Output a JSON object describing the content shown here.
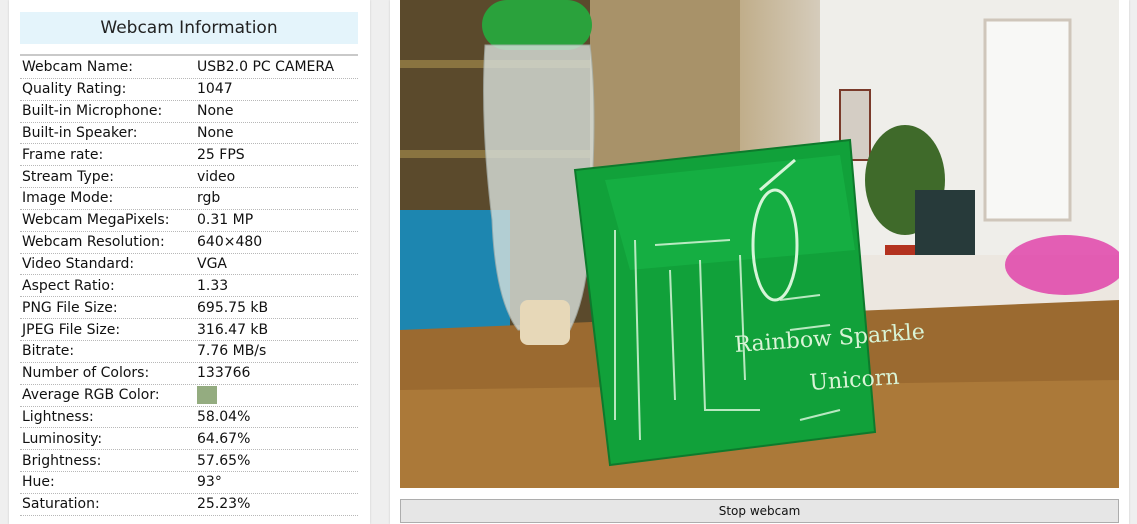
{
  "panel": {
    "title": "Webcam Information"
  },
  "rows": [
    {
      "label": "Webcam Name:",
      "value": "USB2.0 PC CAMERA"
    },
    {
      "label": "Quality Rating:",
      "value": "1047"
    },
    {
      "label": "Built-in Microphone:",
      "value": "None"
    },
    {
      "label": "Built-in Speaker:",
      "value": "None"
    },
    {
      "label": "Frame rate:",
      "value": "25 FPS"
    },
    {
      "label": "Stream Type:",
      "value": "video"
    },
    {
      "label": "Image Mode:",
      "value": "rgb"
    },
    {
      "label": "Webcam MegaPixels:",
      "value": "0.31 MP"
    },
    {
      "label": "Webcam Resolution:",
      "value": "640×480"
    },
    {
      "label": "Video Standard:",
      "value": "VGA"
    },
    {
      "label": "Aspect Ratio:",
      "value": "1.33"
    },
    {
      "label": "PNG File Size:",
      "value": "695.75 kB"
    },
    {
      "label": "JPEG File Size:",
      "value": "316.47 kB"
    },
    {
      "label": "Bitrate:",
      "value": "7.76 MB/s"
    },
    {
      "label": "Number of Colors:",
      "value": "133766"
    },
    {
      "label": "Average RGB Color:",
      "value": ""
    },
    {
      "label": "Lightness:",
      "value": "58.04%"
    },
    {
      "label": "Luminosity:",
      "value": "64.67%"
    },
    {
      "label": "Brightness:",
      "value": "57.65%"
    },
    {
      "label": "Hue:",
      "value": "93°"
    },
    {
      "label": "Saturation:",
      "value": "25.23%"
    }
  ],
  "average_rgb_color": "#94ac80",
  "video": {
    "board_text_1": "Rainbow Sparkle",
    "board_text_2": "Unicorn"
  },
  "controls": {
    "stop_label": "Stop webcam"
  }
}
